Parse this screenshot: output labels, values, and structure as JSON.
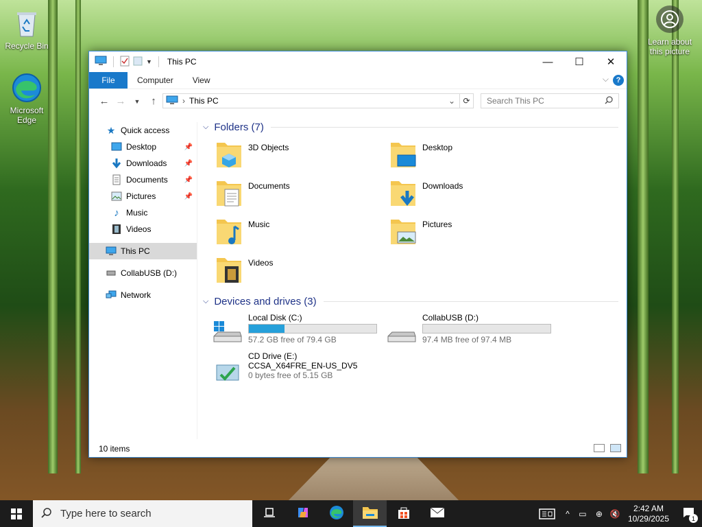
{
  "desktop": {
    "icons": [
      {
        "label": "Recycle Bin",
        "icon": "recycle-bin-icon"
      },
      {
        "label": "Microsoft Edge",
        "icon": "edge-icon"
      }
    ],
    "learn_label": "Learn about this picture"
  },
  "window": {
    "title": "This PC",
    "ribbon": {
      "tabs": [
        "File",
        "Computer",
        "View"
      ]
    },
    "address": {
      "crumb": "This PC",
      "search_placeholder": "Search This PC"
    },
    "sidebar": [
      {
        "label": "Quick access",
        "icon": "star-icon"
      },
      {
        "label": "Desktop",
        "icon": "desktop-icon",
        "pinned": true
      },
      {
        "label": "Downloads",
        "icon": "download-arrow-icon",
        "pinned": true
      },
      {
        "label": "Documents",
        "icon": "document-icon",
        "pinned": true
      },
      {
        "label": "Pictures",
        "icon": "picture-icon",
        "pinned": true
      },
      {
        "label": "Music",
        "icon": "music-note-icon"
      },
      {
        "label": "Videos",
        "icon": "film-icon"
      },
      {
        "label": "This PC",
        "icon": "computer-icon",
        "selected": true
      },
      {
        "label": "CollabUSB (D:)",
        "icon": "usb-drive-icon"
      },
      {
        "label": "Network",
        "icon": "network-icon"
      }
    ],
    "folders_header": "Folders (7)",
    "folders": [
      "3D Objects",
      "Desktop",
      "Documents",
      "Downloads",
      "Music",
      "Pictures",
      "Videos"
    ],
    "drives_header": "Devices and drives (3)",
    "drives": [
      {
        "name": "Local Disk (C:)",
        "free": "57.2 GB free of 79.4 GB",
        "used_fraction": 0.28
      },
      {
        "name": "CollabUSB (D:)",
        "free": "97.4 MB free of 97.4 MB",
        "used_fraction": 0.0
      },
      {
        "name": "CD Drive (E:)",
        "label": "CCSA_X64FRE_EN-US_DV5",
        "free": "0 bytes free of 5.15 GB"
      }
    ],
    "status": "10 items"
  },
  "taskbar": {
    "search_placeholder": "Type here to search",
    "time": "2:42 AM",
    "date": "10/29/2025",
    "notification_count": "1"
  },
  "colors": {
    "accent": "#1979ca",
    "folder": "#f4c64f",
    "drive_bar": "#26a0da"
  }
}
